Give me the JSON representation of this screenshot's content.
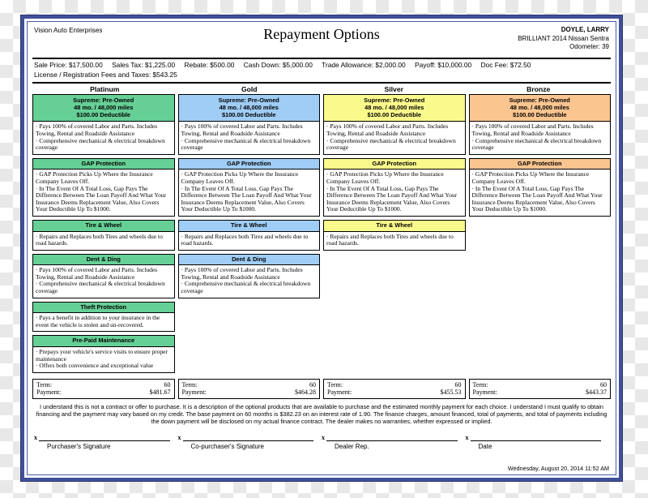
{
  "header": {
    "dealer": "Vision Auto Enterprises",
    "title": "Repayment Options",
    "customer_name": "DOYLE, LARRY",
    "vehicle": "BRILLIANT 2014 Nissan Sentra",
    "odometer": "Odometer: 39"
  },
  "deal": {
    "sale_price": "Sale Price: $17,500.00",
    "sales_tax": "Sales Tax: $1,225.00",
    "rebate": "Rebate: $500.00",
    "cash_down": "Cash Down: $5,000.00",
    "trade_allowance": "Trade Allowance: $2,000.00",
    "payoff": "Payoff: $10,000.00",
    "doc_fee": "Doc Fee: $72.50",
    "license_fees": "License / Registration Fees and Taxes: $543.25"
  },
  "colors": {
    "platinum": "#66cf95",
    "gold": "#9fcdf5",
    "silver": "#fafa8c",
    "bronze": "#fbc590",
    "frame": "#41509a"
  },
  "tiers": [
    {
      "label": "Platinum",
      "color": "#66cf95"
    },
    {
      "label": "Gold",
      "color": "#9fcdf5"
    },
    {
      "label": "Silver",
      "color": "#fafa8c"
    },
    {
      "label": "Bronze",
      "color": "#fbc590"
    }
  ],
  "plan_head": {
    "line1": "Supreme:  Pre-Owned",
    "line2": "48 mo. / 48,000 miles",
    "line3": "$100.00 Deductible",
    "body_1": "· Pays 100% of covered Labor and Parts. Includes Towing, Rental and Roadside Assistance",
    "body_2": "· Comprehensive mechanical & electrical breakdown coverage"
  },
  "products": {
    "gap": {
      "title": "GAP Protection",
      "body_1": "· GAP Protection Picks Up Where the Insurance Company Leaves Off.",
      "body_2": "· In The Event Of A Total Loss, Gap Pays The Difference Between The Loan Payoff And What Your Insurance Deems Replacement Value, Also Covers Your Deductible Up To $1000."
    },
    "tire": {
      "title": "Tire & Wheel",
      "body_1": "· Repairs and Replaces both Tires and wheels due to road hazards."
    },
    "dent": {
      "title": "Dent & Ding",
      "body_1": "· Pays 100% of covered Labor and Parts. Includes Towing, Rental and Roadside Assistance",
      "body_2": "· Comprehensive mechanical & electrical breakdown coverage"
    },
    "theft": {
      "title": "Theft Protection",
      "body_1": "· Pays a benefit in addition to your insurance in the event the vehicle is stolen and un-recovered."
    },
    "maintenance": {
      "title": "Pre-Paid Maintenance",
      "body_1": "· Prepays your vehicle's service visits to ensure proper maintenance",
      "body_2": "· Offers both convenience and exceptional value"
    }
  },
  "terms": {
    "term_label": "Term:",
    "payment_label": "Payment:",
    "platinum": {
      "term": "60",
      "payment": "$481.67"
    },
    "gold": {
      "term": "60",
      "payment": "$464.28"
    },
    "silver": {
      "term": "60",
      "payment": "$455.53"
    },
    "bronze": {
      "term": "60",
      "payment": "$443.37"
    }
  },
  "disclaimer": "I understand this is not a contract or offer to purchase. It is a description of the optional products that are available to purchase and the estimated monthly payment for each choice. I understand I must qualify to obtain financing and the payment may vary based on my credit. The base payment on 60 months is $382.23 on an interest rate of 1.90. The finance charges, amount financed, total of payments, and total of payments including the down payment will be disclosed on my actual finance contract. The dealer makes no warranties, whether expressed or implied.",
  "signatures": [
    {
      "x": "x",
      "label": "Purchaser's Signature"
    },
    {
      "x": "x",
      "label": "Co-purchaser's Signature"
    },
    {
      "x": "x",
      "label": "Dealer Rep."
    },
    {
      "x": "x",
      "label": "Date"
    }
  ],
  "timestamp": "Wednesday, August 20, 2014  11:52 AM"
}
